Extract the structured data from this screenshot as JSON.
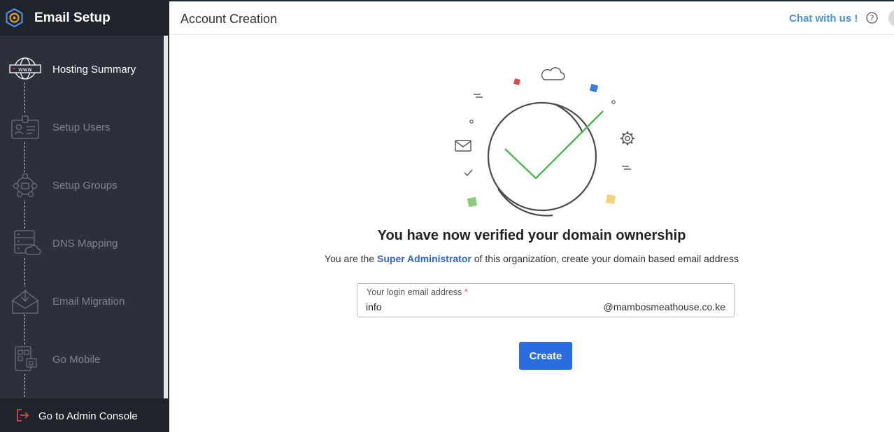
{
  "sidebar": {
    "title": "Email Setup",
    "steps": [
      {
        "label": "Hosting Summary",
        "icon": "globe-www-icon",
        "active": true
      },
      {
        "label": "Setup Users",
        "icon": "user-card-icon",
        "active": false
      },
      {
        "label": "Setup Groups",
        "icon": "group-network-icon",
        "active": false
      },
      {
        "label": "DNS Mapping",
        "icon": "server-cloud-icon",
        "active": false
      },
      {
        "label": "Email Migration",
        "icon": "inbox-download-icon",
        "active": false
      },
      {
        "label": "Go Mobile",
        "icon": "mobile-qr-icon",
        "active": false
      }
    ],
    "footer_label": "Go to Admin Console"
  },
  "header": {
    "title": "Account Creation",
    "chat_label": "Chat with us !"
  },
  "main": {
    "headline": "You have now verified your domain ownership",
    "sub_before": "You are the ",
    "sub_highlight": "Super Administrator",
    "sub_after": " of this organization, create your domain based email address",
    "email_label": "Your login email address",
    "email_required": "*",
    "email_value": "info",
    "email_domain": "@mambosmeathouse.co.ke",
    "create_label": "Create"
  },
  "colors": {
    "sidebar_bg": "#2b303b",
    "accent": "#2a6de0",
    "link": "#4a90e2",
    "check": "#4cb84c"
  }
}
